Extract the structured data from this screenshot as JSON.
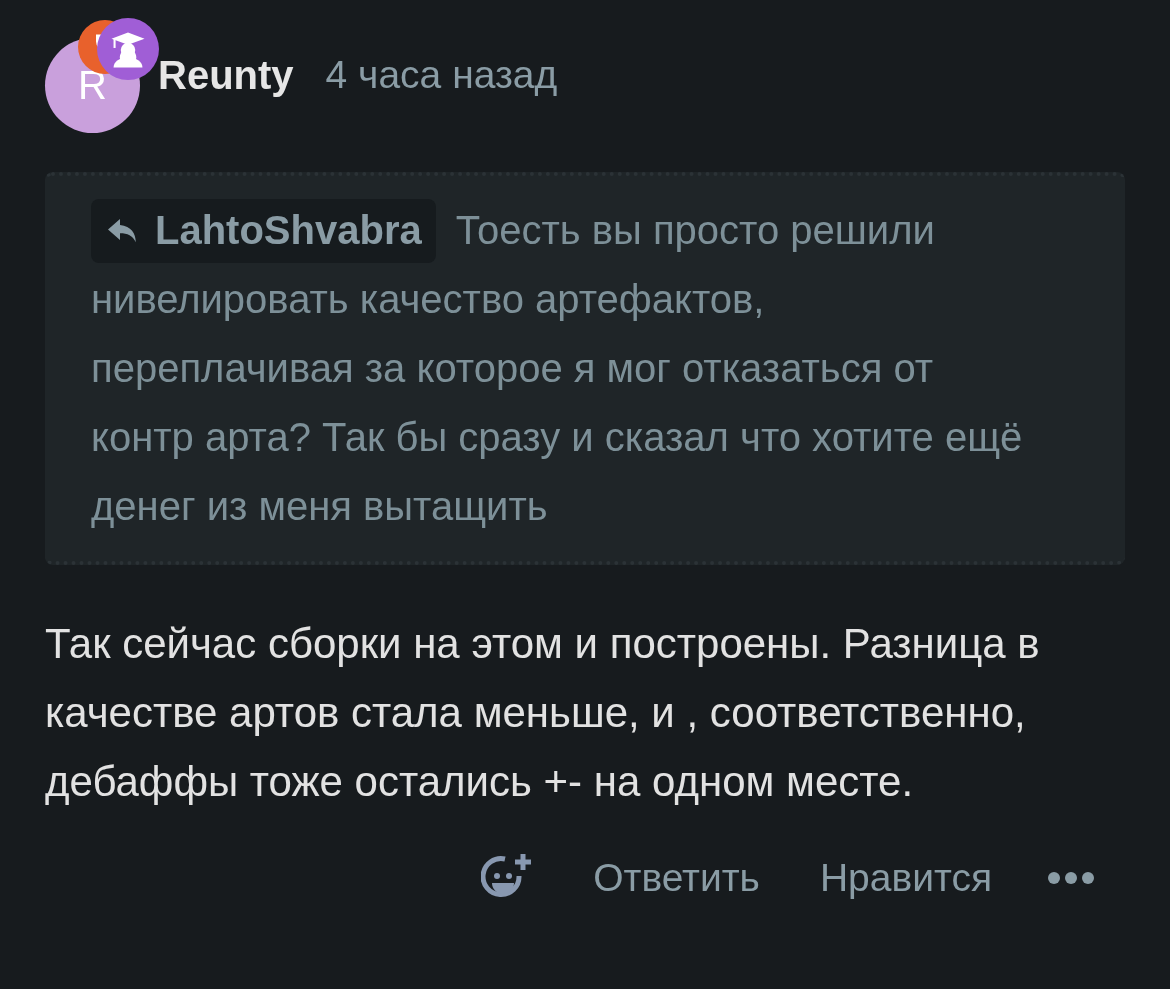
{
  "comment": {
    "author": {
      "initial": "R",
      "name": "Reunty"
    },
    "time": "4 часа назад",
    "quote": {
      "author": "LahtoShvabra",
      "text_first_line": "Тоесть вы просто решили",
      "text_rest": "нивелировать качество артефактов, переплачивая за которое я мог отказаться от контр арта? Так бы сразу и сказал что хотите ещё денег из меня вытащить"
    },
    "body": "Так сейчас сборки на этом и построены. Разница в качестве артов стала меньше, и , соответственно, дебаффы тоже остались +- на одном месте.",
    "actions": [
      "Ответить",
      "Нравится"
    ]
  }
}
